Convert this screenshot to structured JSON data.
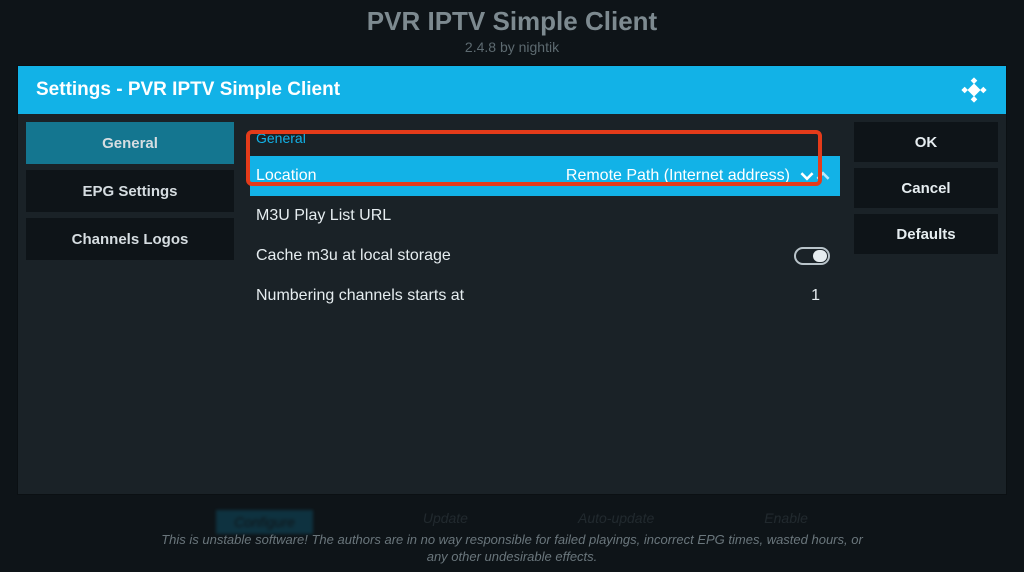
{
  "page": {
    "title": "PVR IPTV Simple Client",
    "version": "2.4.8",
    "by": "by",
    "author": "nightik"
  },
  "dialog": {
    "title": "Settings - PVR IPTV Simple Client"
  },
  "sidebar": {
    "items": [
      {
        "label": "General",
        "active": true
      },
      {
        "label": "EPG Settings",
        "active": false
      },
      {
        "label": "Channels Logos",
        "active": false
      }
    ]
  },
  "content": {
    "section_label": "General",
    "rows": {
      "location": {
        "label": "Location",
        "value": "Remote Path (Internet address)"
      },
      "m3u_url": {
        "label": "M3U Play List URL",
        "value": ""
      },
      "cache": {
        "label": "Cache m3u at local storage",
        "toggle_on": true
      },
      "numbering": {
        "label": "Numbering channels starts at",
        "value": "1"
      }
    }
  },
  "buttons": {
    "ok": "OK",
    "cancel": "Cancel",
    "defaults": "Defaults"
  },
  "bottom_actions": {
    "configure": "Configure",
    "update": "Update",
    "auto_update": "Auto-update",
    "enable": "Enable"
  },
  "footer": {
    "line1": "This is unstable software! The authors are in no way responsible for failed playings, incorrect EPG times, wasted hours, or",
    "line2": "any other undesirable effects."
  }
}
